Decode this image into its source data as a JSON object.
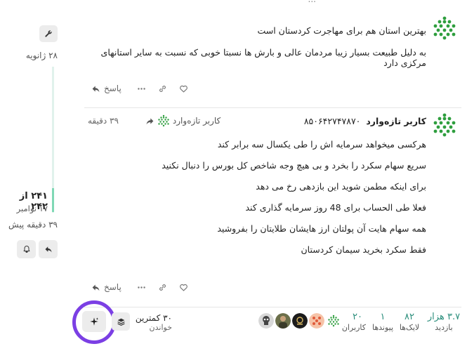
{
  "cut_top_text": "...",
  "post1": {
    "title": "بهترین استان هم برای مهاجرت کردستان است",
    "body": "به دلیل طبیعت بسیار زیبا مردمان عالی و بارش ها نسبتا خوبی که نسبت به سایر استانهای مرکزی دارد",
    "reply_label": "پاسخ"
  },
  "post2": {
    "author_name": "کاربر تازه‌وارد",
    "author_id": "۸۵۰۶۴۲۷۴۷۸۷۰",
    "reply_to": "کاربر تازه‌وارد",
    "time": "۳۹ دقیقه",
    "lines": [
      "هرکسی میخواهد سرمایه اش را طی یکسال سه برابر کند",
      "سریع سهام سکرد را بخرد و بی هیچ وجه شاخص کل بورس را دنبال نکنید",
      "برای اینکه مطمن شوید این بازدهی رخ می دهد",
      "فعلا طی الحساب برای 48 روز سرمایه گذاری کند",
      "همه سهام هایت آن پولتان ارز هایشان طلایتان را بفروشید",
      "فقط سکرد بخرید سیمان کردستان"
    ],
    "reply_label": "پاسخ"
  },
  "timeline": {
    "top_date": "۲۸ ژانویه",
    "position": "۲۴۱ از ۲۴۲",
    "position_date": "۱۷ نوامبر",
    "ago": "۳۹ دقیقه پیش",
    "progress_percent": 99.6
  },
  "bottombar": {
    "readers_count": "۳۰ کمترین",
    "readers_label": "خواندن",
    "stats": [
      {
        "value": "۳.۷ هزار",
        "label": "بازدید"
      },
      {
        "value": "۸۲",
        "label": "لایک‌ها"
      },
      {
        "value": "۱",
        "label": "پیوندها"
      },
      {
        "value": "۲۰",
        "label": "کاربران"
      }
    ]
  },
  "colors": {
    "accent": "#2b8e7c",
    "avatar_green": "#2e9e3e",
    "highlight_ring": "#7b3fe4",
    "timeline_handle": "#7fd8b5"
  },
  "icons": {
    "like": "heart-icon",
    "link": "link-icon",
    "more": "more-icon",
    "reply": "reply-icon",
    "wrench": "wrench-icon",
    "bell": "bell-icon",
    "sparkle": "sparkle-icon",
    "layers": "layers-icon"
  }
}
